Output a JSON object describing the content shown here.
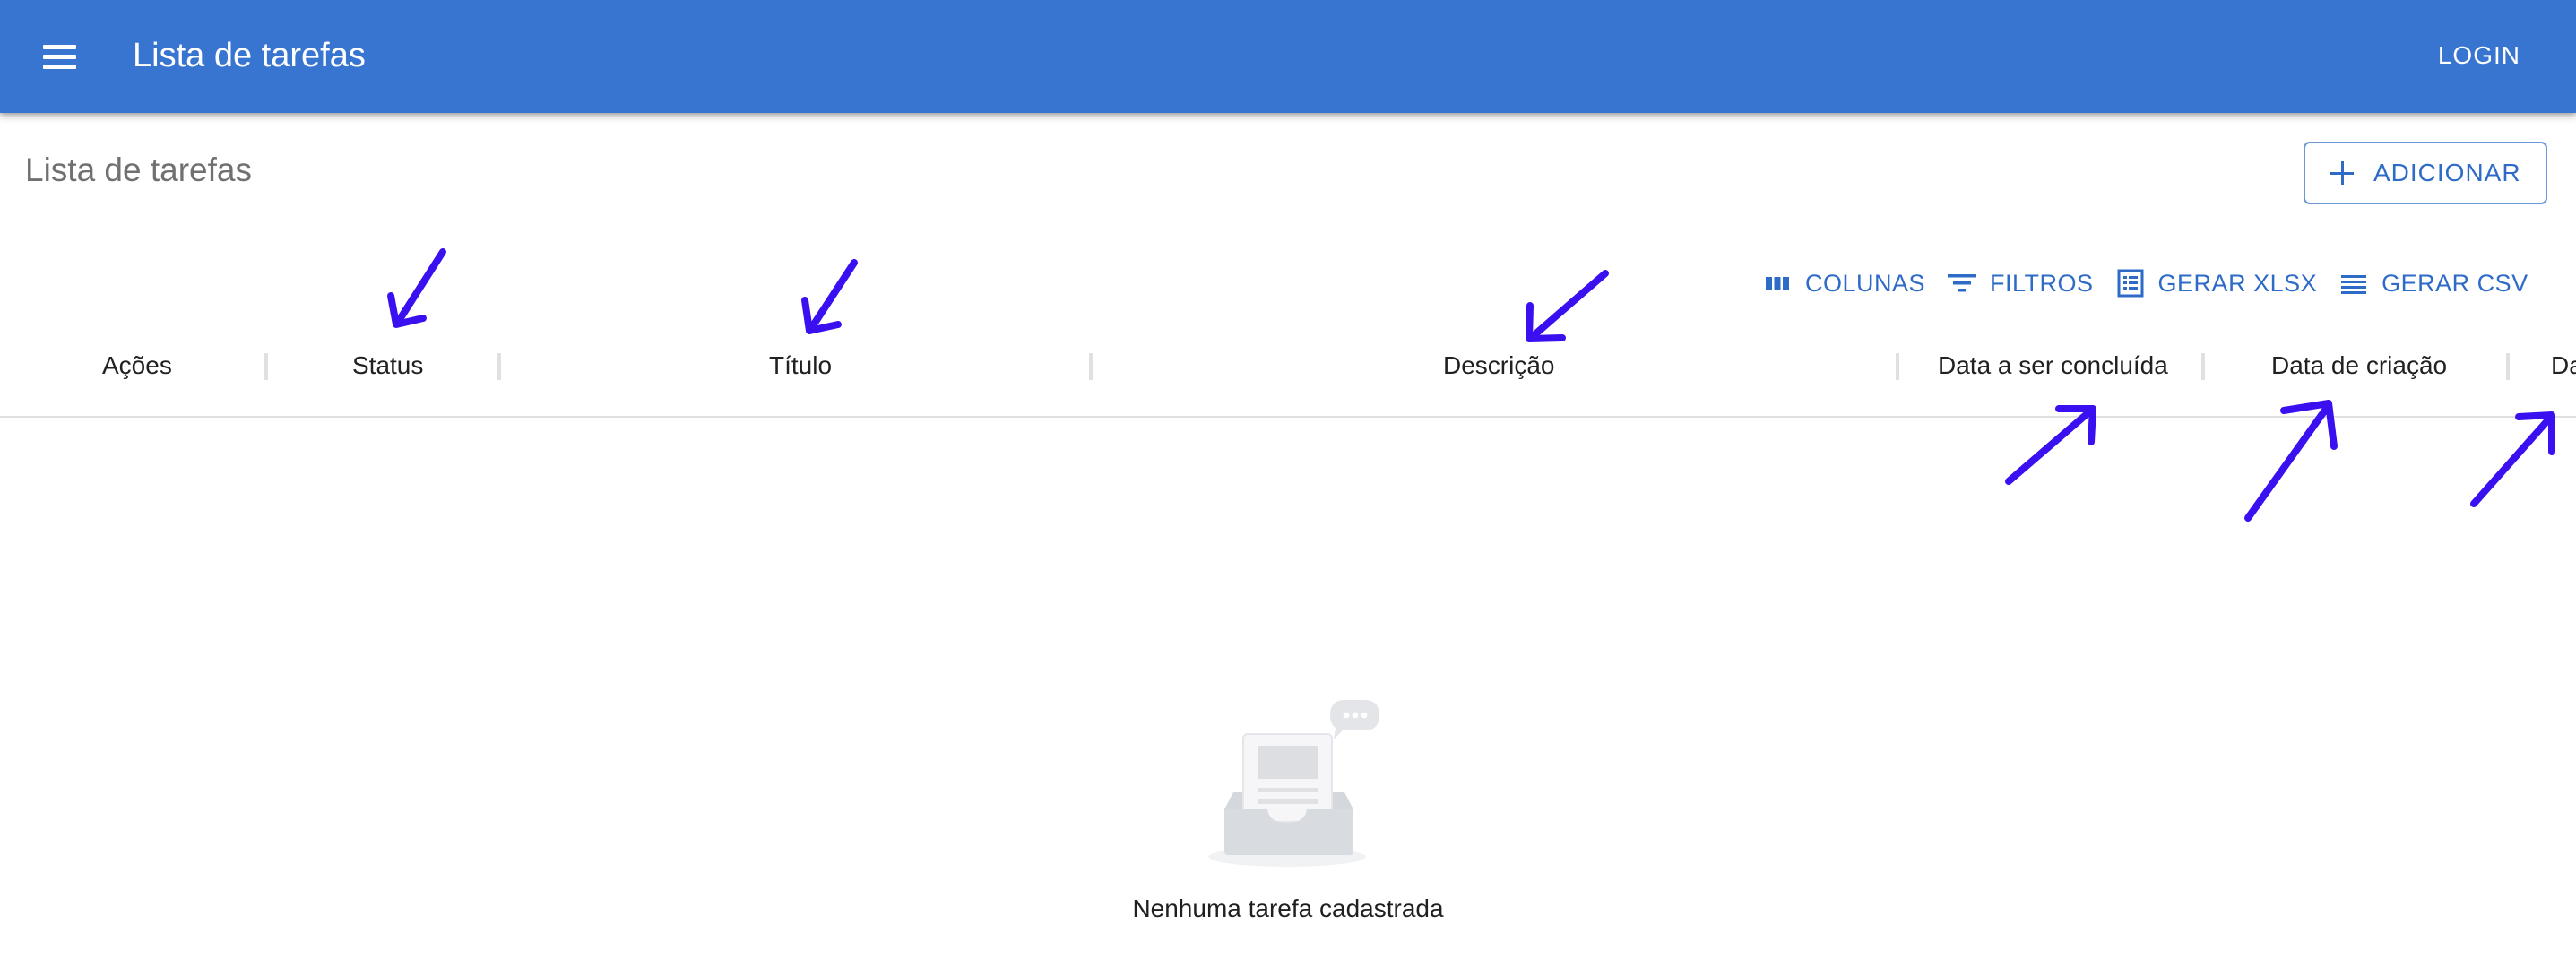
{
  "appbar": {
    "title": "Lista de tarefas",
    "login_label": "LOGIN",
    "color": "#3875d0"
  },
  "page": {
    "title": "Lista de tarefas",
    "add_label": "ADICIONAR"
  },
  "toolbar": {
    "columns_label": "COLUNAS",
    "filters_label": "FILTROS",
    "xlsx_label": "GERAR XLSX",
    "csv_label": "GERAR CSV"
  },
  "table": {
    "columns": [
      "Ações",
      "Status",
      "Título",
      "Descrição",
      "Data a ser concluída",
      "Data de criação",
      "Da"
    ]
  },
  "empty": {
    "text": "Nenhuma tarefa cadastrada"
  },
  "annotations": {
    "arrow_color": "#3a0ff0"
  },
  "icons": [
    "menu-icon",
    "plus-icon",
    "columns-icon",
    "filter-icon",
    "spreadsheet-icon",
    "list-icon",
    "empty-inbox-icon"
  ]
}
